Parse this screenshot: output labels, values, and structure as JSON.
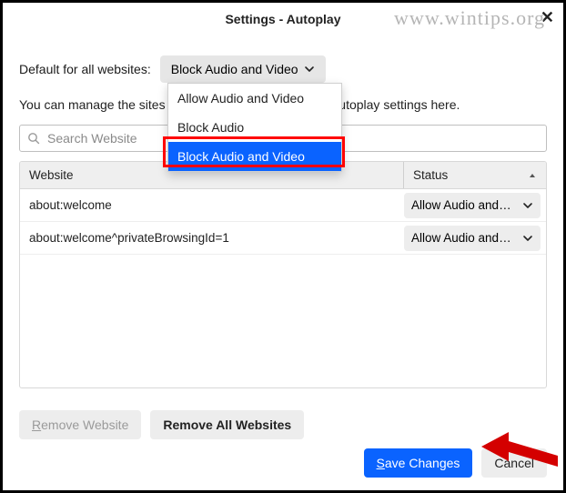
{
  "title": "Settings - Autoplay",
  "watermark": "www.wintips.org",
  "labels": {
    "default_for": "Default for all websites:",
    "manage_desc": "You can manage the sites that do not follow the default autoplay settings here."
  },
  "dropdown": {
    "selected": "Block Audio and Video",
    "options": [
      "Allow Audio and Video",
      "Block Audio",
      "Block Audio and Video"
    ]
  },
  "search": {
    "placeholder": "Search Website"
  },
  "table": {
    "headers": {
      "website": "Website",
      "status": "Status"
    },
    "rows": [
      {
        "website": "about:welcome",
        "status": "Allow Audio and…"
      },
      {
        "website": "about:welcome^privateBrowsingId=1",
        "status": "Allow Audio and…"
      }
    ]
  },
  "buttons": {
    "remove": "Remove Website",
    "remove_all": "Remove All Websites",
    "save": "Save Changes",
    "cancel": "Cancel"
  }
}
